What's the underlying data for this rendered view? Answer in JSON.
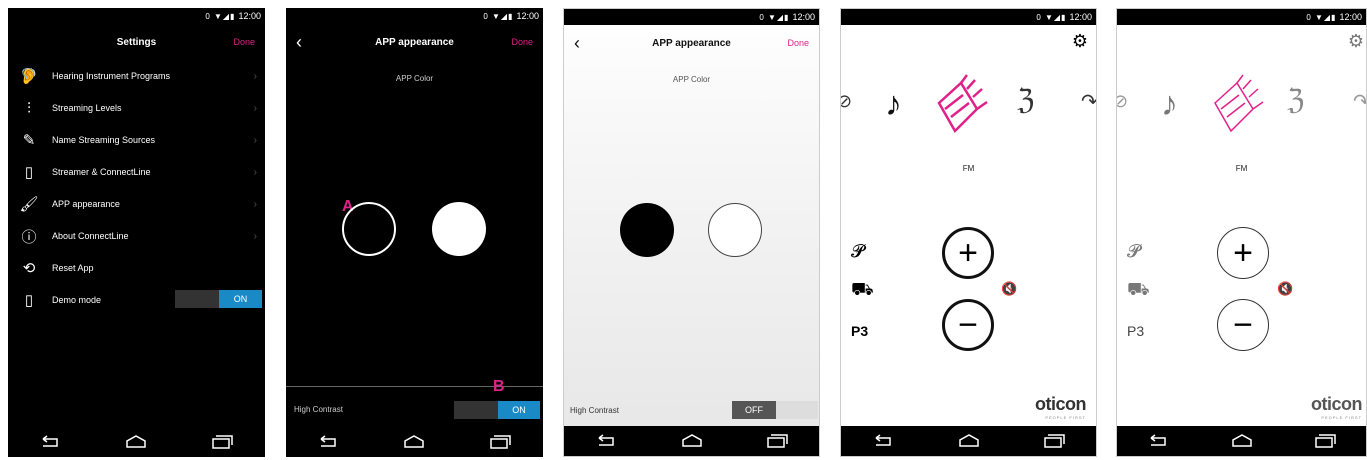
{
  "status": {
    "time": "12:00",
    "icons": "0 ▼◢▮"
  },
  "screen1": {
    "title": "Settings",
    "done": "Done",
    "items": [
      {
        "icon": "ear-icon",
        "glyph": "🦻",
        "label": "Hearing Instrument Programs"
      },
      {
        "icon": "sliders-icon",
        "glyph": "⫶",
        "label": "Streaming Levels"
      },
      {
        "icon": "pencil-icon",
        "glyph": "✎",
        "label": "Name Streaming Sources"
      },
      {
        "icon": "streamer-icon",
        "glyph": "▯",
        "label": "Streamer & ConnectLine"
      },
      {
        "icon": "brush-icon",
        "glyph": "🖌",
        "label": "APP appearance"
      },
      {
        "icon": "info-icon",
        "glyph": "ⓘ",
        "label": "About ConnectLine"
      },
      {
        "icon": "reset-icon",
        "glyph": "⟲",
        "label": "Reset App"
      },
      {
        "icon": "phone-icon",
        "glyph": "▯",
        "label": "Demo mode"
      }
    ],
    "demo_toggle": "ON"
  },
  "screen2": {
    "title": "APP appearance",
    "done": "Done",
    "subtitle": "APP Color",
    "marker_a": "A",
    "marker_b": "B",
    "high_contrast": "High Contrast",
    "toggle": "ON"
  },
  "screen3": {
    "title": "APP appearance",
    "done": "Done",
    "subtitle": "APP Color",
    "high_contrast": "High Contrast",
    "toggle": "OFF"
  },
  "screen4": {
    "program_label": "FM",
    "program_num": "P3",
    "plus": "+",
    "minus": "−",
    "logo": "oticon",
    "logo_tag": "PEOPLE FIRST"
  },
  "screen5": {
    "program_label": "FM",
    "program_num": "P3",
    "plus": "+",
    "minus": "−",
    "logo": "oticon",
    "logo_tag": "PEOPLE FIRST"
  },
  "colors": {
    "accent": "#e0218a",
    "toggle_on": "#1a8ac6"
  }
}
